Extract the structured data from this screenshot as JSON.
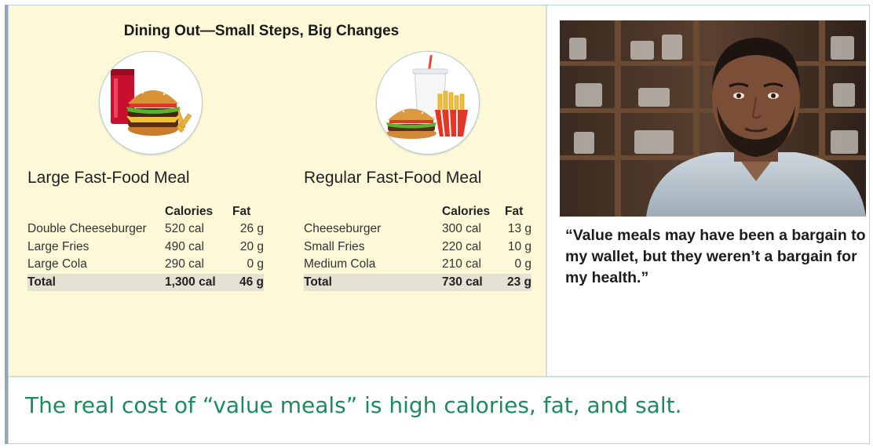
{
  "panel_title": "Dining Out—Small Steps, Big Changes",
  "large_meal": {
    "heading": "Large Fast-Food Meal",
    "col_calories": "Calories",
    "col_fat": "Fat",
    "rows": [
      {
        "item": "Double Cheeseburger",
        "calories": "520 cal",
        "fat": "26 g"
      },
      {
        "item": "Large Fries",
        "calories": "490 cal",
        "fat": "20 g"
      },
      {
        "item": "Large Cola",
        "calories": "290 cal",
        "fat": "0 g"
      }
    ],
    "total": {
      "item": "Total",
      "calories": "1,300 cal",
      "fat": "46 g"
    }
  },
  "regular_meal": {
    "heading": "Regular Fast-Food Meal",
    "col_calories": "Calories",
    "col_fat": "Fat",
    "rows": [
      {
        "item": "Cheeseburger",
        "calories": "300 cal",
        "fat": "13 g"
      },
      {
        "item": "Small Fries",
        "calories": "220 cal",
        "fat": "10 g"
      },
      {
        "item": "Medium Cola",
        "calories": "210 cal",
        "fat": "0 g"
      }
    ],
    "total": {
      "item": "Total",
      "calories": "730 cal",
      "fat": "23 g"
    }
  },
  "quote": "“Value meals may have been a bargain to my wallet, but they weren’t a bargain for my health.”",
  "bottom_caption": "The real cost of “value meals” is high calories, fat, and salt.",
  "colors": {
    "panel_background": "#fdf8d8",
    "caption_green": "#1a8c5c",
    "border_blue": "#b9cfdc"
  }
}
